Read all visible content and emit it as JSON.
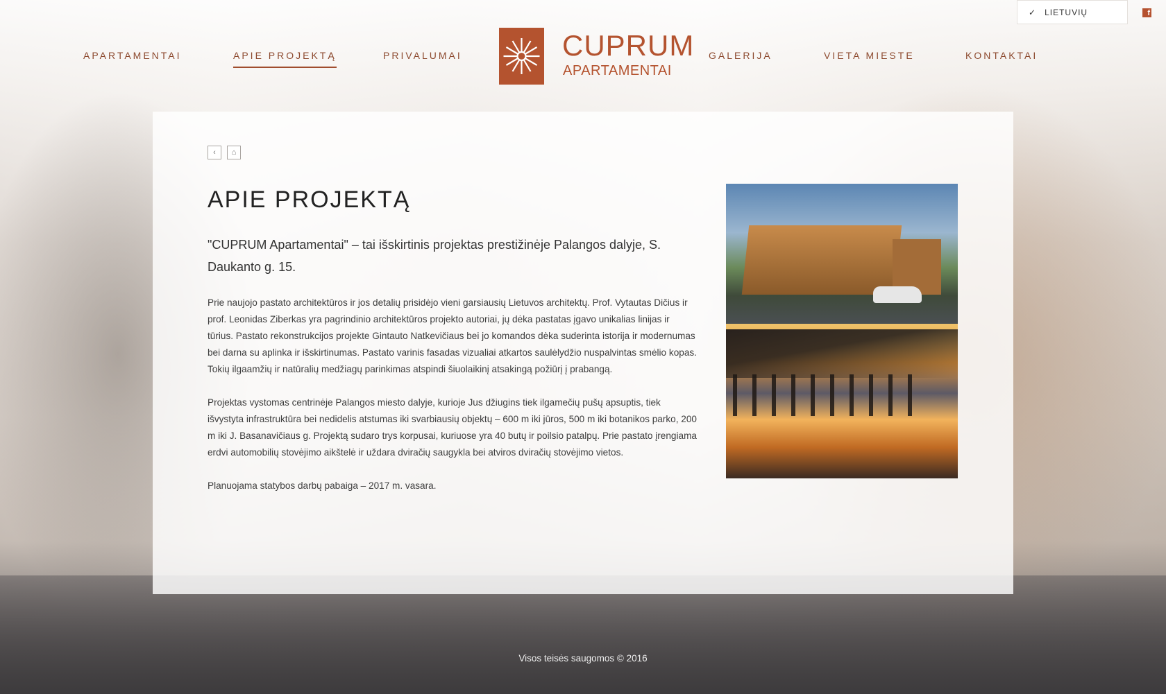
{
  "language": {
    "checkmark": "✓",
    "label": "LIETUVIŲ"
  },
  "social": {
    "facebook_glyph": "f"
  },
  "nav": {
    "items": [
      {
        "label": "APARTAMENTAI"
      },
      {
        "label": "APIE PROJEKTĄ",
        "active": true
      },
      {
        "label": "PRIVALUMAI"
      },
      {
        "label": "GALERIJA"
      },
      {
        "label": "VIETA MIESTE"
      },
      {
        "label": "KONTAKTAI"
      }
    ]
  },
  "logo": {
    "line1": "CUPRUM",
    "line2": "APARTAMENTAI"
  },
  "breadcrumbs": {
    "back_glyph": "‹",
    "home_glyph": "⌂"
  },
  "page": {
    "title": "APIE PROJEKTĄ",
    "lead": "\"CUPRUM Apartamentai\" – tai išskirtinis projektas prestižinėje Palangos dalyje, S. Daukanto g. 15.",
    "paragraphs": [
      "Prie naujojo pastato architektūros ir jos detalių prisidėjo vieni garsiausių Lietuvos architektų. Prof. Vytautas Dičius ir prof. Leonidas Ziberkas yra pagrindinio architektūros projekto autoriai, jų dėka pastatas įgavo unikalias linijas ir tūrius. Pastato rekonstrukcijos projekte Gintauto Natkevičiaus bei jo komandos dėka suderinta istorija ir modernumas bei darna su aplinka ir išskirtinumas. Pastato varinis fasadas vizualiai atkartos saulėlydžio nuspalvintas smėlio kopas. Tokių ilgaamžių ir natūralių medžiagų parinkimas atspindi šiuolaikinį atsakingą požiūrį į prabangą.",
      "Projektas vystomas centrinėje Palangos miesto dalyje, kurioje Jus džiugins tiek ilgamečių pušų apsuptis, tiek išvystyta infrastruktūra bei nedidelis atstumas iki svarbiausių objektų – 600 m iki jūros, 500 m iki botanikos parko, 200 m iki J. Basanavičiaus g. Projektą sudaro trys korpusai, kuriuose yra 40 butų ir poilsio patalpų. Prie pastato įrengiama erdvi automobilių stovėjimo aikštelė ir uždara dviračių saugykla bei atviros dviračių stovėjimo vietos.",
      "Planuojama statybos darbų pabaiga – 2017 m. vasara."
    ]
  },
  "footer": {
    "text": "Visos teisės saugomos © 2016"
  },
  "colors": {
    "brand": "#b4532f",
    "nav_text": "#8d4a2f"
  }
}
